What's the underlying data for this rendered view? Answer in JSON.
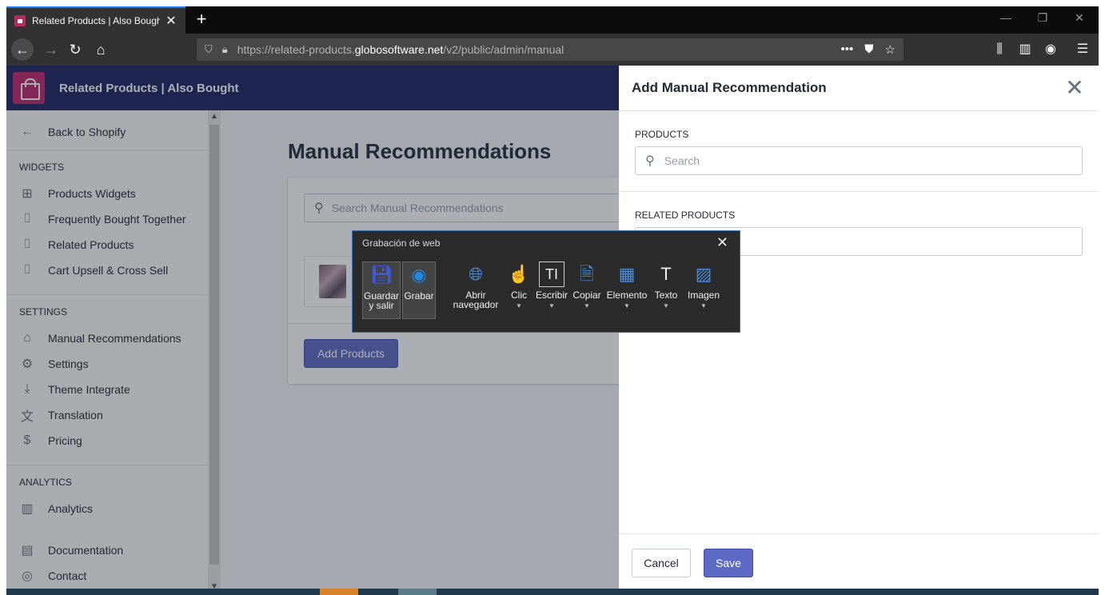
{
  "browser": {
    "tab_title": "Related Products | Also Bought",
    "url_prefix": "https://related-products.",
    "url_host": "globosoftware.net",
    "url_path": "/v2/public/admin/manual"
  },
  "app": {
    "title": "Related Products | Also Bought"
  },
  "sidebar": {
    "back": "Back to Shopify",
    "widgets_heading": "WIDGETS",
    "widgets": [
      "Products Widgets",
      "Frequently Bought Together",
      "Related Products",
      "Cart Upsell & Cross Sell"
    ],
    "settings_heading": "SETTINGS",
    "settings": [
      "Manual Recommendations",
      "Settings",
      "Theme Integrate",
      "Translation",
      "Pricing"
    ],
    "analytics_heading": "ANALYTICS",
    "analytics": "Analytics",
    "documentation": "Documentation",
    "contact": "Contact"
  },
  "main": {
    "title": "Manual Recommendations",
    "search_placeholder": "Search Manual Recommendations",
    "add_button": "Add Products"
  },
  "panel": {
    "title": "Add Manual Recommendation",
    "products_label": "PRODUCTS",
    "products_placeholder": "Search",
    "related_label": "RELATED PRODUCTS",
    "cancel": "Cancel",
    "save": "Save"
  },
  "recorder": {
    "title": "Grabación de web",
    "tools": [
      {
        "label": "Guardar y salir",
        "icon": "save-icon"
      },
      {
        "label": "Grabar",
        "icon": "record-icon"
      },
      {
        "label": "Abrir navegador",
        "icon": "globe-icon"
      },
      {
        "label": "Clic",
        "icon": "click-icon"
      },
      {
        "label": "Escribir",
        "icon": "type-icon"
      },
      {
        "label": "Copiar",
        "icon": "copy-icon"
      },
      {
        "label": "Elemento",
        "icon": "element-icon"
      },
      {
        "label": "Texto",
        "icon": "text-icon"
      },
      {
        "label": "Imagen",
        "icon": "image-icon"
      }
    ]
  }
}
